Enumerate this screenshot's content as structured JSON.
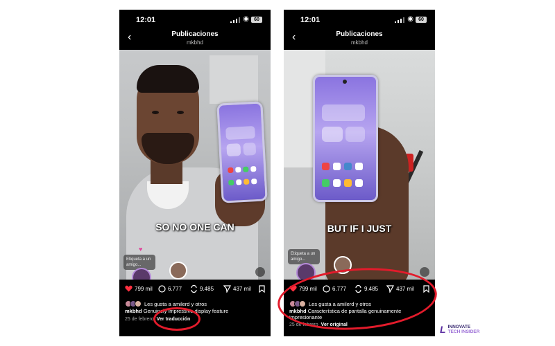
{
  "left": {
    "status_time": "12:01",
    "battery": "60",
    "nav_title": "Publicaciones",
    "nav_username": "mkbhd",
    "caption": "SO NO ONE CAN",
    "tag_prompt": "Etiqueta a un amigo...",
    "actions": {
      "likes": "799 mil",
      "comments": "6.777",
      "reposts": "9.485",
      "shares": "437 mil"
    },
    "likes_text": "Les gusta a amilerd y otros",
    "username": "mkbhd",
    "description": "Genuinely impressive display feature",
    "date": "25 de febrero",
    "translation_link": "Ver traducción"
  },
  "right": {
    "status_time": "12:01",
    "battery": "60",
    "nav_title": "Publicaciones",
    "nav_username": "mkbhd",
    "caption": "BUT IF I JUST",
    "tag_prompt": "Etiqueta a un amigo...",
    "actions": {
      "likes": "799 mil",
      "comments": "6.777",
      "reposts": "9.485",
      "shares": "437 mil"
    },
    "likes_text": "Les gusta a amilerd y otros",
    "username": "mkbhd",
    "description": "Característica de pantalla genuinamente impresionante",
    "date": "25 de febrero",
    "translation_link": "Ver original"
  },
  "brand": {
    "line1": "INNOVATE",
    "line2": "TECH INSIDER"
  },
  "colors": {
    "heart": "#ff3040",
    "highlight_ring": "#e21b2b",
    "brand": "#5a2ca0"
  }
}
